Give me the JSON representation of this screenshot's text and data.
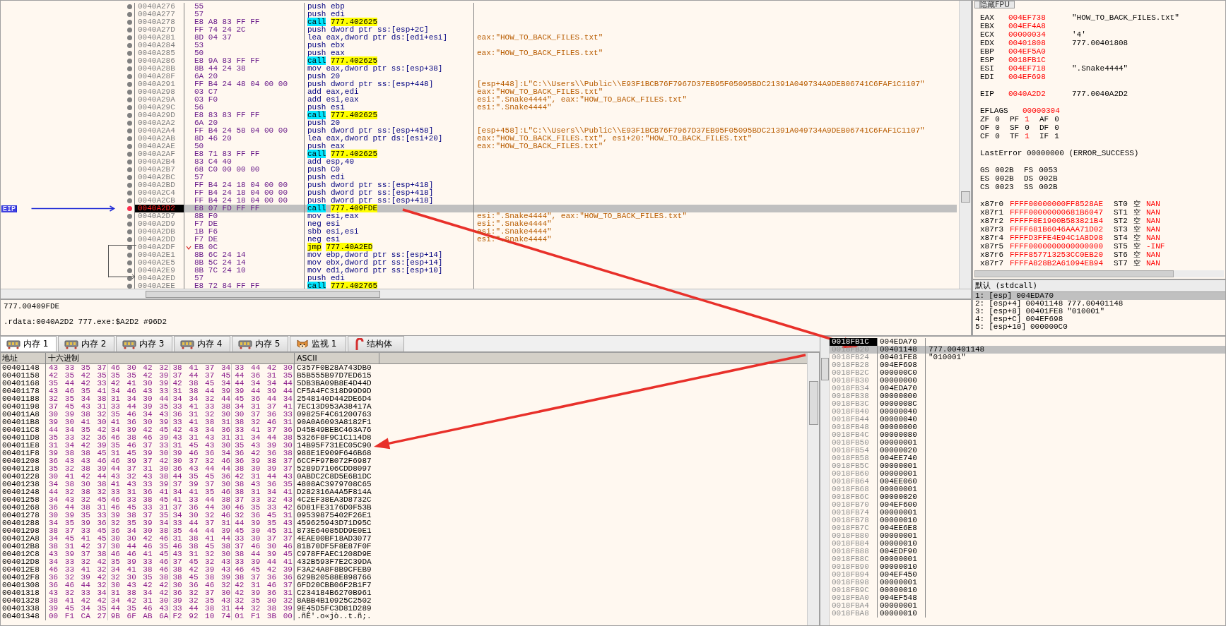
{
  "disassembly": {
    "eip_label": "EIP",
    "rows": [
      {
        "address": "0040A276",
        "bytes": "55",
        "mnemonic": "push",
        "operands": "ebp",
        "kind": "normal",
        "selected": false
      },
      {
        "address": "0040A277",
        "bytes": "57",
        "mnemonic": "push",
        "operands": "edi",
        "kind": "normal",
        "selected": false
      },
      {
        "address": "0040A278",
        "bytes": "E8 A8 83 FF FF",
        "mnemonic": "call",
        "operands": "777.402625",
        "kind": "call",
        "selected": false
      },
      {
        "address": "0040A27D",
        "bytes": "FF 74 24 2C",
        "mnemonic": "push",
        "operands": "dword ptr ss:[esp+2C]",
        "kind": "normal",
        "selected": false
      },
      {
        "address": "0040A281",
        "bytes": "8D 04 37",
        "mnemonic": "lea",
        "operands": "eax,dword ptr ds:[edi+esi]",
        "comment": "eax:\"HOW_TO_BACK_FILES.txt\"",
        "kind": "normal",
        "selected": false
      },
      {
        "address": "0040A284",
        "bytes": "53",
        "mnemonic": "push",
        "operands": "ebx",
        "kind": "normal",
        "selected": false
      },
      {
        "address": "0040A285",
        "bytes": "50",
        "mnemonic": "push",
        "operands": "eax",
        "comment": "eax:\"HOW_TO_BACK_FILES.txt\"",
        "kind": "normal",
        "selected": false
      },
      {
        "address": "0040A286",
        "bytes": "E8 9A 83 FF FF",
        "mnemonic": "call",
        "operands": "777.402625",
        "kind": "call",
        "selected": false
      },
      {
        "address": "0040A28B",
        "bytes": "8B 44 24 38",
        "mnemonic": "mov",
        "operands": "eax,dword ptr ss:[esp+38]",
        "kind": "normal",
        "selected": false
      },
      {
        "address": "0040A28F",
        "bytes": "6A 20",
        "mnemonic": "push",
        "operands": "20",
        "kind": "normal",
        "selected": false
      },
      {
        "address": "0040A291",
        "bytes": "FF B4 24 48 04 00 00",
        "mnemonic": "push",
        "operands": "dword ptr ss:[esp+448]",
        "comment": "[esp+448]:L\"C:\\\\Users\\\\Public\\\\E93F1BCB76F7967D37EB95F05095BDC21391A049734A9DEB06741C6FAF1C1107\"",
        "kind": "normal",
        "selected": false
      },
      {
        "address": "0040A298",
        "bytes": "03 C7",
        "mnemonic": "add",
        "operands": "eax,edi",
        "comment": "eax:\"HOW_TO_BACK_FILES.txt\"",
        "kind": "normal",
        "selected": false
      },
      {
        "address": "0040A29A",
        "bytes": "03 F0",
        "mnemonic": "add",
        "operands": "esi,eax",
        "comment": "esi:\".Snake4444\", eax:\"HOW_TO_BACK_FILES.txt\"",
        "kind": "normal",
        "selected": false
      },
      {
        "address": "0040A29C",
        "bytes": "56",
        "mnemonic": "push",
        "operands": "esi",
        "comment": "esi:\".Snake4444\"",
        "kind": "normal",
        "selected": false
      },
      {
        "address": "0040A29D",
        "bytes": "E8 83 83 FF FF",
        "mnemonic": "call",
        "operands": "777.402625",
        "kind": "call",
        "selected": false
      },
      {
        "address": "0040A2A2",
        "bytes": "6A 20",
        "mnemonic": "push",
        "operands": "20",
        "kind": "normal",
        "selected": false
      },
      {
        "address": "0040A2A4",
        "bytes": "FF B4 24 58 04 00 00",
        "mnemonic": "push",
        "operands": "dword ptr ss:[esp+458]",
        "comment": "[esp+458]:L\"C:\\\\Users\\\\Public\\\\E93F1BCB76F7967D37EB95F05095BDC21391A049734A9DEB06741C6FAF1C1107\"",
        "kind": "normal",
        "selected": false
      },
      {
        "address": "0040A2AB",
        "bytes": "8D 46 20",
        "mnemonic": "lea",
        "operands": "eax,dword ptr ds:[esi+20]",
        "comment": "eax:\"HOW_TO_BACK_FILES.txt\", esi+20:\"HOW_TO_BACK_FILES.txt\"",
        "kind": "normal",
        "selected": false
      },
      {
        "address": "0040A2AE",
        "bytes": "50",
        "mnemonic": "push",
        "operands": "eax",
        "comment": "eax:\"HOW_TO_BACK_FILES.txt\"",
        "kind": "normal",
        "selected": false
      },
      {
        "address": "0040A2AF",
        "bytes": "E8 71 83 FF FF",
        "mnemonic": "call",
        "operands": "777.402625",
        "kind": "call",
        "selected": false
      },
      {
        "address": "0040A2B4",
        "bytes": "83 C4 40",
        "mnemonic": "add",
        "operands": "esp,40",
        "kind": "normal",
        "selected": false
      },
      {
        "address": "0040A2B7",
        "bytes": "68 C0 00 00 00",
        "mnemonic": "push",
        "operands": "C0",
        "kind": "normal",
        "selected": false
      },
      {
        "address": "0040A2BC",
        "bytes": "57",
        "mnemonic": "push",
        "operands": "edi",
        "kind": "normal",
        "selected": false
      },
      {
        "address": "0040A2BD",
        "bytes": "FF B4 24 18 04 00 00",
        "mnemonic": "push",
        "operands": "dword ptr ss:[esp+418]",
        "kind": "normal",
        "selected": false
      },
      {
        "address": "0040A2C4",
        "bytes": "FF B4 24 18 04 00 00",
        "mnemonic": "push",
        "operands": "dword ptr ss:[esp+418]",
        "kind": "normal",
        "selected": false
      },
      {
        "address": "0040A2CB",
        "bytes": "FF B4 24 18 04 00 00",
        "mnemonic": "push",
        "operands": "dword ptr ss:[esp+418]",
        "kind": "normal",
        "selected": false
      },
      {
        "address": "0040A2D2",
        "bytes": "E8 07 FD FF FF",
        "mnemonic": "call",
        "operands": "777.409FDE",
        "kind": "call",
        "selected": true
      },
      {
        "address": "0040A2D7",
        "bytes": "8B F0",
        "mnemonic": "mov",
        "operands": "esi,eax",
        "comment": "esi:\".Snake4444\", eax:\"HOW_TO_BACK_FILES.txt\"",
        "kind": "normal",
        "selected": false
      },
      {
        "address": "0040A2D9",
        "bytes": "F7 DE",
        "mnemonic": "neg",
        "operands": "esi",
        "comment": "esi:\".Snake4444\"",
        "kind": "normal",
        "selected": false
      },
      {
        "address": "0040A2DB",
        "bytes": "1B F6",
        "mnemonic": "sbb",
        "operands": "esi,esi",
        "comment": "esi:\".Snake4444\"",
        "kind": "normal",
        "selected": false
      },
      {
        "address": "0040A2DD",
        "bytes": "F7 DE",
        "mnemonic": "neg",
        "operands": "esi",
        "comment": "esi:\".Snake4444\"",
        "kind": "normal",
        "selected": false
      },
      {
        "address": "0040A2DF",
        "bytes": "EB 0C",
        "mnemonic": "jmp",
        "operands": "777.40A2ED",
        "kind": "jmp",
        "selected": false
      },
      {
        "address": "0040A2E1",
        "bytes": "8B 6C 24 14",
        "mnemonic": "mov",
        "operands": "ebp,dword ptr ss:[esp+14]",
        "kind": "normal",
        "selected": false
      },
      {
        "address": "0040A2E5",
        "bytes": "8B 5C 24 14",
        "mnemonic": "mov",
        "operands": "ebx,dword ptr ss:[esp+14]",
        "kind": "normal",
        "selected": false
      },
      {
        "address": "0040A2E9",
        "bytes": "8B 7C 24 10",
        "mnemonic": "mov",
        "operands": "edi,dword ptr ss:[esp+10]",
        "kind": "normal",
        "selected": false
      },
      {
        "address": "0040A2ED",
        "bytes": "57",
        "mnemonic": "push",
        "operands": "edi",
        "kind": "jump_target",
        "selected": false
      },
      {
        "address": "0040A2EE",
        "bytes": "E8 72 84 FF FF",
        "mnemonic": "call",
        "operands": "777.402765",
        "kind": "call",
        "selected": false
      }
    ]
  },
  "info": [
    "777.00409FDE",
    ".rdata:0040A2D2 777.exe:$A2D2 #96D2"
  ],
  "registers": {
    "fpu_toggle": "隐藏FPU",
    "general": [
      {
        "name": "EAX",
        "value": "004EF738",
        "comment": "\"HOW_TO_BACK_FILES.txt\"",
        "changed": true
      },
      {
        "name": "EBX",
        "value": "004EF4A8",
        "changed": true
      },
      {
        "name": "ECX",
        "value": "00000034",
        "comment": "'4'",
        "changed": true
      },
      {
        "name": "EDX",
        "value": "00401808",
        "comment": "777.00401808",
        "changed": true
      },
      {
        "name": "EBP",
        "value": "004EF5A0",
        "changed": true
      },
      {
        "name": "ESP",
        "value": "0018FB1C",
        "changed": true
      },
      {
        "name": "ESI",
        "value": "004EF718",
        "comment": "\".Snake4444\"",
        "changed": true
      },
      {
        "name": "EDI",
        "value": "004EF698",
        "changed": true
      }
    ],
    "eip": {
      "name": "EIP",
      "value": "0040A2D2",
      "comment": "777.0040A2D2",
      "changed": true
    },
    "eflags": {
      "name": "EFLAGS",
      "value": "00000304",
      "changed": true
    },
    "flags": [
      {
        "name": "ZF",
        "value": "0",
        "changed": false
      },
      {
        "name": "PF",
        "value": "1",
        "changed": true
      },
      {
        "name": "AF",
        "value": "0",
        "changed": false
      },
      {
        "name": "OF",
        "value": "0",
        "changed": false
      },
      {
        "name": "SF",
        "value": "0",
        "changed": false
      },
      {
        "name": "DF",
        "value": "0",
        "changed": false
      },
      {
        "name": "CF",
        "value": "0",
        "changed": false
      },
      {
        "name": "TF",
        "value": "1",
        "changed": true
      },
      {
        "name": "IF",
        "value": "1",
        "changed": false
      }
    ],
    "last_error": "LastError 00000000 (ERROR_SUCCESS)",
    "segments": [
      {
        "name": "GS",
        "value": "002B"
      },
      {
        "name": "FS",
        "value": "0053"
      },
      {
        "name": "ES",
        "value": "002B"
      },
      {
        "name": "DS",
        "value": "002B"
      },
      {
        "name": "CS",
        "value": "0023"
      },
      {
        "name": "SS",
        "value": "002B"
      }
    ],
    "fpu": [
      {
        "name": "x87r0",
        "value": "FFFF00000000FF8528AE",
        "st": "ST0",
        "tag": "空",
        "result": "NAN"
      },
      {
        "name": "x87r1",
        "value": "FFFF00000000681B6047",
        "st": "ST1",
        "tag": "空",
        "result": "NAN"
      },
      {
        "name": "x87r2",
        "value": "FFFFF0E1900B583821B4",
        "st": "ST2",
        "tag": "空",
        "result": "NAN"
      },
      {
        "name": "x87r3",
        "value": "FFFF681B6046AAA71D02",
        "st": "ST3",
        "tag": "空",
        "result": "NAN"
      },
      {
        "name": "x87r4",
        "value": "FFFFD3FFE4E94C1A8D98",
        "st": "ST4",
        "tag": "空",
        "result": "NAN"
      },
      {
        "name": "x87r5",
        "value": "FFFF0000000000000000",
        "st": "ST5",
        "tag": "空",
        "result": "-INF"
      },
      {
        "name": "x87r6",
        "value": "FFFF857713253CC0EB20",
        "st": "ST6",
        "tag": "空",
        "result": "NAN"
      },
      {
        "name": "x87r7",
        "value": "FFFFA828B2A61094EB94",
        "st": "ST7",
        "tag": "空",
        "result": "NAN"
      }
    ]
  },
  "call_stack": {
    "title": "默认 (stdcall)",
    "entries": [
      {
        "index": "1:",
        "slot": "[esp]",
        "value": "004EDA70",
        "selected": true
      },
      {
        "index": "2:",
        "slot": "[esp+4]",
        "value": "00401148",
        "comment": "777.00401148",
        "selected": false
      },
      {
        "index": "3:",
        "slot": "[esp+8]",
        "value": "00401FE8",
        "comment": "\"010001\"",
        "selected": false
      },
      {
        "index": "4:",
        "slot": "[esp+C]",
        "value": "004EF698",
        "selected": false
      },
      {
        "index": "5:",
        "slot": "[esp+10]",
        "value": "000000C0",
        "selected": false
      }
    ]
  },
  "tabs": [
    {
      "label": "内存 1",
      "kind": "memory",
      "selected": true
    },
    {
      "label": "内存 2",
      "kind": "memory",
      "selected": false
    },
    {
      "label": "内存 3",
      "kind": "memory",
      "selected": false
    },
    {
      "label": "内存 4",
      "kind": "memory",
      "selected": false
    },
    {
      "label": "内存 5",
      "kind": "memory",
      "selected": false
    },
    {
      "label": "监视 1",
      "kind": "watch",
      "selected": false
    },
    {
      "label": "结构体",
      "kind": "struct",
      "selected": false
    }
  ],
  "dump": {
    "columns": [
      "地址",
      "十六进制",
      "ASCII"
    ],
    "rows": [
      {
        "address": "00401148",
        "hex": [
          "43 33 35 37",
          "46 30 42 32",
          "38 41 37 34",
          "33 44 42 30"
        ],
        "ascii": "C357F0B28A743DB0"
      },
      {
        "address": "00401158",
        "hex": [
          "42 35 42 35",
          "35 35 42 39",
          "37 44 37 45",
          "44 36 31 35"
        ],
        "ascii": "B5B555B97D7ED615"
      },
      {
        "address": "00401168",
        "hex": [
          "35 44 42 33",
          "42 41 30 39",
          "42 38 45 34",
          "44 34 34 44"
        ],
        "ascii": "5DB3BA09B8E4D44D"
      },
      {
        "address": "00401178",
        "hex": [
          "43 46 35 41",
          "34 46 43 33",
          "31 38 44 39",
          "39 44 39 44"
        ],
        "ascii": "CF5A4FC318D99D9D"
      },
      {
        "address": "00401188",
        "hex": [
          "32 35 34 38",
          "31 34 30 44",
          "34 34 32 44",
          "45 36 44 34"
        ],
        "ascii": "2548140D442DE6D4"
      },
      {
        "address": "00401198",
        "hex": [
          "37 45 43 31",
          "33 44 39 35",
          "33 41 33 38",
          "34 31 37 41"
        ],
        "ascii": "7EC13D953A38417A"
      },
      {
        "address": "004011A8",
        "hex": [
          "30 39 38 32",
          "35 46 34 43",
          "36 31 32 30",
          "30 37 36 33"
        ],
        "ascii": "09825F4C61200763"
      },
      {
        "address": "004011B8",
        "hex": [
          "39 30 41 30",
          "41 36 30 39",
          "33 41 38 31",
          "38 32 46 31"
        ],
        "ascii": "90A0A6093A8182F1"
      },
      {
        "address": "004011C8",
        "hex": [
          "44 34 35 42",
          "34 39 42 45",
          "42 43 34 36",
          "33 41 37 36"
        ],
        "ascii": "D45B49BEBC463A76"
      },
      {
        "address": "004011D8",
        "hex": [
          "35 33 32 36",
          "46 38 46 39",
          "43 31 43 31",
          "31 34 44 38"
        ],
        "ascii": "5326F8F9C1C114D8"
      },
      {
        "address": "004011E8",
        "hex": [
          "31 34 42 39",
          "35 46 37 33",
          "31 45 43 30",
          "35 43 39 30"
        ],
        "ascii": "14B95F731EC05C90"
      },
      {
        "address": "004011F8",
        "hex": [
          "39 38 38 45",
          "31 45 39 30",
          "39 46 36 34",
          "36 42 36 38"
        ],
        "ascii": "988E1E909F646B68"
      },
      {
        "address": "00401208",
        "hex": [
          "36 43 43 46",
          "46 39 37 42",
          "30 37 32 46",
          "36 39 38 37"
        ],
        "ascii": "6CCFF97B072F6987"
      },
      {
        "address": "00401218",
        "hex": [
          "35 32 38 39",
          "44 37 31 30",
          "36 43 44 44",
          "38 30 39 37"
        ],
        "ascii": "5289D7106CDD8097"
      },
      {
        "address": "00401228",
        "hex": [
          "30 41 42 44",
          "43 32 43 38",
          "44 35 45 36",
          "42 31 44 43"
        ],
        "ascii": "0ABDC2C8D5E6B1DC"
      },
      {
        "address": "00401238",
        "hex": [
          "34 38 30 38",
          "41 43 33 39",
          "37 39 37 30",
          "38 43 36 35"
        ],
        "ascii": "4808AC3979708C65"
      },
      {
        "address": "00401248",
        "hex": [
          "44 32 38 32",
          "33 31 36 41",
          "34 41 35 46",
          "38 31 34 41"
        ],
        "ascii": "D282316A4A5F814A"
      },
      {
        "address": "00401258",
        "hex": [
          "34 43 32 45",
          "46 33 38 45",
          "41 33 44 38",
          "37 33 32 43"
        ],
        "ascii": "4C2EF38EA3D8732C"
      },
      {
        "address": "00401268",
        "hex": [
          "36 44 38 31",
          "46 45 33 31",
          "37 36 44 30",
          "46 35 33 42"
        ],
        "ascii": "6D81FE3176D0F53B"
      },
      {
        "address": "00401278",
        "hex": [
          "30 39 35 33",
          "39 38 37 35",
          "34 30 32 46",
          "32 36 45 31"
        ],
        "ascii": "09539875402F26E1"
      },
      {
        "address": "00401288",
        "hex": [
          "34 35 39 36",
          "32 35 39 34",
          "33 44 37 31",
          "44 39 35 43"
        ],
        "ascii": "459625943D71D95C"
      },
      {
        "address": "00401298",
        "hex": [
          "38 37 33 45",
          "36 34 30 38",
          "35 44 44 39",
          "45 30 45 31"
        ],
        "ascii": "873E64085DD9E0E1"
      },
      {
        "address": "004012A8",
        "hex": [
          "34 45 41 45",
          "30 30 42 46",
          "31 38 41 44",
          "33 30 37 37"
        ],
        "ascii": "4EAE00BF18AD3077"
      },
      {
        "address": "004012B8",
        "hex": [
          "38 31 42 37",
          "30 44 46 35",
          "46 38 45 38",
          "37 46 30 46"
        ],
        "ascii": "81B70DF5F8E87F0F"
      },
      {
        "address": "004012C8",
        "hex": [
          "43 39 37 38",
          "46 46 41 45",
          "43 31 32 30",
          "38 44 39 45"
        ],
        "ascii": "C978FFAEC1208D9E"
      },
      {
        "address": "004012D8",
        "hex": [
          "34 33 32 42",
          "35 39 33 46",
          "37 45 32 43",
          "33 39 44 41"
        ],
        "ascii": "432B593F7E2C39DA"
      },
      {
        "address": "004012E8",
        "hex": [
          "46 33 41 32",
          "34 41 38 46",
          "38 42 39 43",
          "46 45 42 39"
        ],
        "ascii": "F3A24A8F8B9CFEB9"
      },
      {
        "address": "004012F8",
        "hex": [
          "36 32 39 42",
          "32 30 35 38",
          "38 45 38 39",
          "38 37 36 36"
        ],
        "ascii": "629B20588E898766"
      },
      {
        "address": "00401308",
        "hex": [
          "36 46 44 32",
          "30 43 42 42",
          "30 36 46 32",
          "42 31 46 37"
        ],
        "ascii": "6FD20CBB06F2B1F7"
      },
      {
        "address": "00401318",
        "hex": [
          "43 32 33 34",
          "31 38 34 42",
          "36 32 37 30",
          "42 39 36 31"
        ],
        "ascii": "C234184B6270B961"
      },
      {
        "address": "00401328",
        "hex": [
          "38 41 42 42",
          "34 42 31 30",
          "39 32 35 43",
          "32 35 30 32"
        ],
        "ascii": "8ABB4B10925C2502"
      },
      {
        "address": "00401338",
        "hex": [
          "39 45 34 35",
          "44 35 46 43",
          "33 44 38 31",
          "44 32 38 39"
        ],
        "ascii": "9E45D5FC3D81D289"
      },
      {
        "address": "00401348",
        "hex": [
          "00 F1 CA 27",
          "9B 6F AB 6A",
          "F2 92 10 74",
          "01 F1 3B 00"
        ],
        "ascii": ".ñÊ'.o«jò..t.ñ;."
      }
    ]
  },
  "stack": {
    "rows": [
      {
        "address": "0018FB1C",
        "value": "004EDA70",
        "current": true,
        "selected": false
      },
      {
        "address": "0018FB20",
        "value": "00401148",
        "comment": "777.00401148",
        "current": false,
        "selected": true
      },
      {
        "address": "0018FB24",
        "value": "00401FE8",
        "comment": "\"010001\"",
        "current": false,
        "selected": false
      },
      {
        "address": "0018FB28",
        "value": "004EF698",
        "current": false,
        "selected": false
      },
      {
        "address": "0018FB2C",
        "value": "000000C0",
        "current": false,
        "selected": false
      },
      {
        "address": "0018FB30",
        "value": "00000000",
        "current": false,
        "selected": false
      },
      {
        "address": "0018FB34",
        "value": "004EDA70",
        "current": false,
        "selected": false
      },
      {
        "address": "0018FB38",
        "value": "00000000",
        "current": false,
        "selected": false
      },
      {
        "address": "0018FB3C",
        "value": "0000008C",
        "current": false,
        "selected": false
      },
      {
        "address": "0018FB40",
        "value": "00000040",
        "current": false,
        "selected": false
      },
      {
        "address": "0018FB44",
        "value": "00000040",
        "current": false,
        "selected": false
      },
      {
        "address": "0018FB48",
        "value": "00000000",
        "current": false,
        "selected": false
      },
      {
        "address": "0018FB4C",
        "value": "00000080",
        "current": false,
        "selected": false
      },
      {
        "address": "0018FB50",
        "value": "00000001",
        "current": false,
        "selected": false
      },
      {
        "address": "0018FB54",
        "value": "00000020",
        "current": false,
        "selected": false
      },
      {
        "address": "0018FB58",
        "value": "004EE740",
        "current": false,
        "selected": false
      },
      {
        "address": "0018FB5C",
        "value": "00000001",
        "current": false,
        "selected": false
      },
      {
        "address": "0018FB60",
        "value": "00000001",
        "current": false,
        "selected": false
      },
      {
        "address": "0018FB64",
        "value": "004EE060",
        "current": false,
        "selected": false
      },
      {
        "address": "0018FB68",
        "value": "00000001",
        "current": false,
        "selected": false
      },
      {
        "address": "0018FB6C",
        "value": "00000020",
        "current": false,
        "selected": false
      },
      {
        "address": "0018FB70",
        "value": "004EF600",
        "current": false,
        "selected": false
      },
      {
        "address": "0018FB74",
        "value": "00000001",
        "current": false,
        "selected": false
      },
      {
        "address": "0018FB78",
        "value": "00000010",
        "current": false,
        "selected": false
      },
      {
        "address": "0018FB7C",
        "value": "004EE6E8",
        "current": false,
        "selected": false
      },
      {
        "address": "0018FB80",
        "value": "00000001",
        "current": false,
        "selected": false
      },
      {
        "address": "0018FB84",
        "value": "00000010",
        "current": false,
        "selected": false
      },
      {
        "address": "0018FB88",
        "value": "004EDF90",
        "current": false,
        "selected": false
      },
      {
        "address": "0018FB8C",
        "value": "00000001",
        "current": false,
        "selected": false
      },
      {
        "address": "0018FB90",
        "value": "00000010",
        "current": false,
        "selected": false
      },
      {
        "address": "0018FB94",
        "value": "004EF450",
        "current": false,
        "selected": false
      },
      {
        "address": "0018FB98",
        "value": "00000001",
        "current": false,
        "selected": false
      },
      {
        "address": "0018FB9C",
        "value": "00000010",
        "current": false,
        "selected": false
      },
      {
        "address": "0018FBA0",
        "value": "004EF548",
        "current": false,
        "selected": false
      },
      {
        "address": "0018FBA4",
        "value": "00000001",
        "current": false,
        "selected": false
      },
      {
        "address": "0018FBA8",
        "value": "00000010",
        "current": false,
        "selected": false
      }
    ]
  }
}
